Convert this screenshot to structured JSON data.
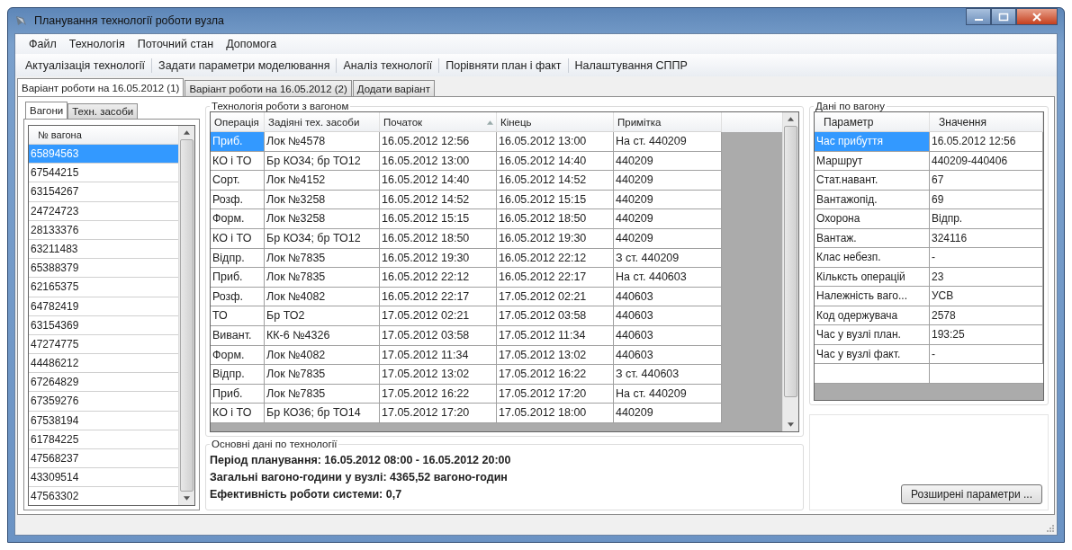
{
  "window": {
    "title": "Планування технології роботи вузла"
  },
  "menu": [
    "Файл",
    "Технологія",
    "Поточний стан",
    "Допомога"
  ],
  "toolbar": [
    "Актуалізація технології",
    "Задати параметри моделювання",
    "Аналіз технології",
    "Порівняти план і факт",
    "Налаштування СППР"
  ],
  "tabs": [
    {
      "label": "Варіант роботи на 16.05.2012 (1)",
      "selected": true
    },
    {
      "label": "Варіант роботи на 16.05.2012 (2)",
      "selected": false
    },
    {
      "label": "Додати варіант",
      "selected": false
    }
  ],
  "left_tabs": [
    {
      "label": "Вагони",
      "selected": true
    },
    {
      "label": "Техн. засоби",
      "selected": false
    }
  ],
  "wagon_list": {
    "header": "№ вагона",
    "items": [
      {
        "text": "65894563",
        "selected": true
      },
      {
        "text": "67544215",
        "selected": false
      },
      {
        "text": "63154267",
        "selected": false
      },
      {
        "text": "24724723",
        "selected": false
      },
      {
        "text": "28133376",
        "selected": false
      },
      {
        "text": "63211483",
        "selected": false
      },
      {
        "text": "65388379",
        "selected": false
      },
      {
        "text": "62165375",
        "selected": false
      },
      {
        "text": "64782419",
        "selected": false
      },
      {
        "text": "63154369",
        "selected": false
      },
      {
        "text": "47274775",
        "selected": false
      },
      {
        "text": "44486212",
        "selected": false
      },
      {
        "text": "67264829",
        "selected": false
      },
      {
        "text": "67359276",
        "selected": false
      },
      {
        "text": "67538194",
        "selected": false
      },
      {
        "text": "61784225",
        "selected": false
      },
      {
        "text": "47568237",
        "selected": false
      },
      {
        "text": "43309514",
        "selected": false
      },
      {
        "text": "47563302",
        "selected": false
      }
    ]
  },
  "operations": {
    "title": "Технологія роботи з вагоном",
    "columns": [
      {
        "label": "Операція",
        "sorted": false
      },
      {
        "label": "Задіяні тех. засоби",
        "sorted": false
      },
      {
        "label": "Початок",
        "sorted": true
      },
      {
        "label": "Кінець",
        "sorted": false
      },
      {
        "label": "Примітка",
        "sorted": false
      }
    ],
    "rows": [
      {
        "cells": [
          "Приб.",
          "Лок №4578",
          "16.05.2012 12:56",
          "16.05.2012 13:00",
          "На ст. 440209"
        ],
        "selected": true
      },
      {
        "cells": [
          "КО і ТО",
          "Бр КО34; бр ТО12",
          "16.05.2012 13:00",
          "16.05.2012 14:40",
          "440209"
        ],
        "selected": false
      },
      {
        "cells": [
          "Сорт.",
          "Лок №4152",
          "16.05.2012 14:40",
          "16.05.2012 14:52",
          "440209"
        ],
        "selected": false
      },
      {
        "cells": [
          "Розф.",
          "Лок  №3258",
          "16.05.2012 14:52",
          "16.05.2012 15:15",
          "440209"
        ],
        "selected": false
      },
      {
        "cells": [
          "Форм.",
          "Лок  №3258",
          "16.05.2012 15:15",
          "16.05.2012 18:50",
          "440209"
        ],
        "selected": false
      },
      {
        "cells": [
          "КО і ТО",
          "Бр КО34; бр ТО12",
          "16.05.2012 18:50",
          "16.05.2012 19:30",
          "440209"
        ],
        "selected": false
      },
      {
        "cells": [
          "Відпр.",
          "Лок №7835",
          "16.05.2012 19:30",
          "16.05.2012 22:12",
          "З ст. 440209"
        ],
        "selected": false
      },
      {
        "cells": [
          "Приб.",
          "Лок №7835",
          "16.05.2012 22:12",
          "16.05.2012 22:17",
          "На ст. 440603"
        ],
        "selected": false
      },
      {
        "cells": [
          "Розф.",
          "Лок  №4082",
          "16.05.2012 22:17",
          "17.05.2012 02:21",
          "440603"
        ],
        "selected": false
      },
      {
        "cells": [
          "ТО",
          "Бр ТО2",
          "17.05.2012 02:21",
          "17.05.2012 03:58",
          "440603"
        ],
        "selected": false
      },
      {
        "cells": [
          "Вивант.",
          "КК-6 №4326",
          "17.05.2012 03:58",
          "17.05.2012 11:34",
          "440603"
        ],
        "selected": false
      },
      {
        "cells": [
          "Форм.",
          "Лок  №4082",
          "17.05.2012 11:34",
          "17.05.2012 13:02",
          "440603"
        ],
        "selected": false
      },
      {
        "cells": [
          "Відпр.",
          "Лок №7835",
          "17.05.2012 13:02",
          "17.05.2012 16:22",
          "З ст. 440603"
        ],
        "selected": false
      },
      {
        "cells": [
          "Приб.",
          "Лок №7835",
          "17.05.2012 16:22",
          "17.05.2012 17:20",
          "На ст. 440209"
        ],
        "selected": false
      },
      {
        "cells": [
          "КО і ТО",
          "Бр КО36; бр ТО14",
          "17.05.2012 17:20",
          "17.05.2012 18:00",
          "440209"
        ],
        "selected": false
      }
    ]
  },
  "summary": {
    "title": "Основні дані по технології",
    "lines": [
      "Період планування: 16.05.2012 08:00 - 16.05.2012 20:00",
      "Загальні вагоно-години у вузлі: 4365,52 вагоно-годин",
      "Ефективність роботи системи: 0,7"
    ]
  },
  "wagon_data": {
    "title": "Дані по вагону",
    "columns": [
      "Параметр",
      "Значення"
    ],
    "rows": [
      {
        "cells": [
          "Час прибуття",
          "16.05.2012 12:56"
        ],
        "selected": true
      },
      {
        "cells": [
          "Маршрут",
          "440209-440406"
        ],
        "selected": false
      },
      {
        "cells": [
          "Стат.навант.",
          "67"
        ],
        "selected": false
      },
      {
        "cells": [
          "Вантажопід.",
          "69"
        ],
        "selected": false
      },
      {
        "cells": [
          "Охорона",
          "Відпр."
        ],
        "selected": false
      },
      {
        "cells": [
          "Вантаж.",
          "324116"
        ],
        "selected": false
      },
      {
        "cells": [
          "Клас небезп.",
          "-"
        ],
        "selected": false
      },
      {
        "cells": [
          "Кільксть операцій",
          "23"
        ],
        "selected": false
      },
      {
        "cells": [
          "Належність ваго...",
          "УСВ"
        ],
        "selected": false
      },
      {
        "cells": [
          "Код одержувача",
          "2578"
        ],
        "selected": false
      },
      {
        "cells": [
          "Час у вузлі план.",
          "193:25"
        ],
        "selected": false
      },
      {
        "cells": [
          "Час у вузлі факт.",
          "-"
        ],
        "selected": false
      }
    ]
  },
  "advanced_button": "Розширені параметри ..."
}
